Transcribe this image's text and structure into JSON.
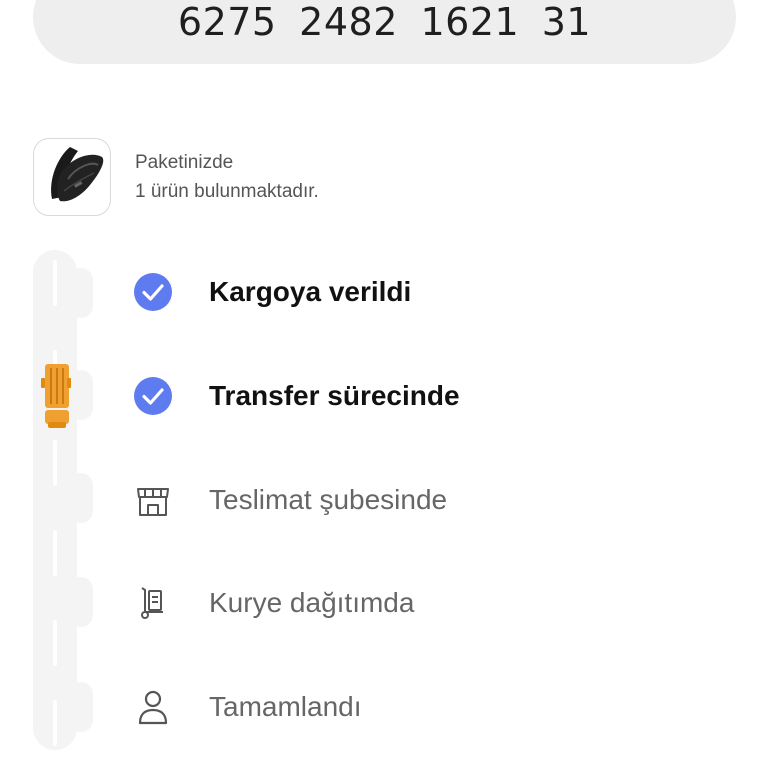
{
  "tracking": {
    "number": "6275  2482  1621  31"
  },
  "package": {
    "line1": "Paketinizde",
    "line2": "1 ürün bulunmaktadır.",
    "image_icon": "sling-bag-icon"
  },
  "steps": [
    {
      "label": "Kargoya verildi",
      "status": "done",
      "icon": "check-circle-icon"
    },
    {
      "label": "Transfer sürecinde",
      "status": "done",
      "icon": "check-circle-icon"
    },
    {
      "label": "Teslimat şubesinde",
      "status": "pending",
      "icon": "store-icon"
    },
    {
      "label": "Kurye dağıtımda",
      "status": "pending",
      "icon": "hand-truck-icon"
    },
    {
      "label": "Tamamlandı",
      "status": "pending",
      "icon": "person-icon"
    }
  ],
  "progress": {
    "current_step_index": 1,
    "indicator_icon": "truck-icon"
  },
  "colors": {
    "check": "#5f7bf0",
    "truck": "#f0a030",
    "road": "#f4f4f4"
  }
}
